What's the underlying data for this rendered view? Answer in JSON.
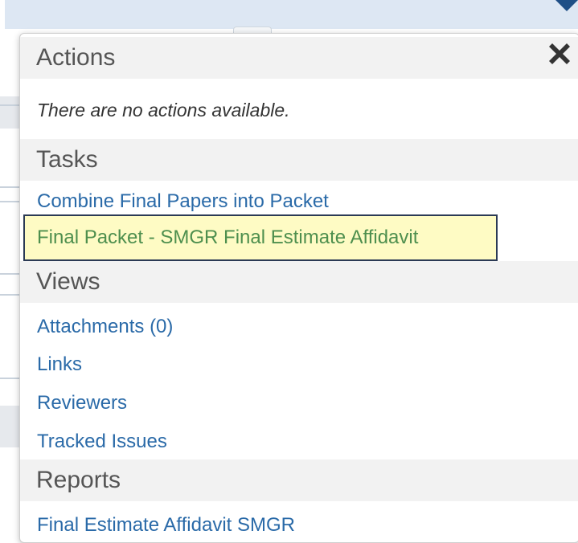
{
  "actions": {
    "header": "Actions",
    "empty_message": "There are no actions available."
  },
  "tasks": {
    "header": "Tasks",
    "items": [
      "Combine Final Papers into Packet",
      "Final Packet - SMGR Final Estimate Affidavit"
    ]
  },
  "views": {
    "header": "Views",
    "items": [
      "Attachments (0)",
      "Links",
      "Reviewers",
      "Tracked Issues"
    ]
  },
  "reports": {
    "header": "Reports",
    "items": [
      "Final Estimate Affidavit SMGR"
    ]
  },
  "icons": {
    "close": "close-icon",
    "dropdown": "caret-down-icon"
  },
  "colors": {
    "link": "#2a6aa8",
    "header_bg": "#f2f2f2",
    "highlight_bg": "#fefbc4",
    "highlight_border": "#2b3a55",
    "highlight_text": "#4e8f4e"
  }
}
